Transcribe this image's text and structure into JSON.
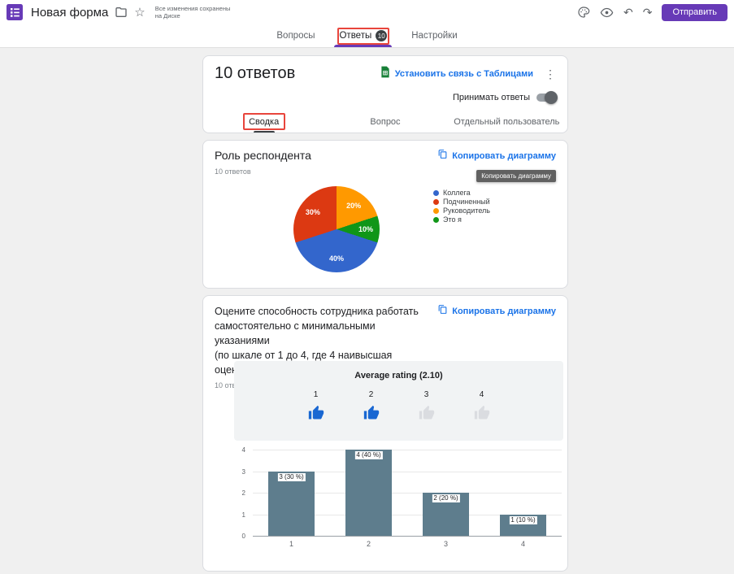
{
  "colors": {
    "accent": "#673ab7",
    "link": "#1a73e8",
    "annotation": "#e8453c",
    "bar": "#5e7d8d",
    "thumb_filled": "#1967d2",
    "thumb_empty": "#dadce0"
  },
  "topbar": {
    "app_title": "Новая форма",
    "saved_line1": "Все изменения сохранены",
    "saved_line2": "на Диске",
    "send_button": "Отправить"
  },
  "nav_tabs": {
    "questions": "Вопросы",
    "answers": "Ответы",
    "answers_badge": "10",
    "settings": "Настройки"
  },
  "summary_card": {
    "title": "10 ответов",
    "sheets_link": "Установить связь с Таблицами",
    "accepting_toggle_label": "Принимать ответы",
    "tab_summary": "Сводка",
    "tab_question": "Вопрос",
    "tab_individual": "Отдельный пользователь"
  },
  "pie_card": {
    "title": "Роль респондента",
    "responses_label": "10 ответов",
    "copy_chart_link": "Копировать диаграмму",
    "copy_chart_tooltip": "Копировать диаграмму"
  },
  "rating_card": {
    "title": "Оцените способность сотрудника работать самостоятельно с минимальными указаниями",
    "scale_note": "(по шкале от 1 до 4, где 4 наивысшая оценка)",
    "responses_label": "10 ответов",
    "copy_chart_link": "Копировать диаграмму",
    "average_title": "Average rating (2.10)"
  },
  "chart_data": [
    {
      "type": "pie",
      "title": "Роль респондента",
      "responses": 10,
      "slices": [
        {
          "label": "Коллега",
          "percent": 40,
          "color": "#3366cc"
        },
        {
          "label": "Подчиненный",
          "percent": 30,
          "color": "#dc3912"
        },
        {
          "label": "Руководитель",
          "percent": 20,
          "color": "#ff9900"
        },
        {
          "label": "Это я",
          "percent": 10,
          "color": "#109618"
        }
      ],
      "draw_order_clockwise_from_top": [
        2,
        3,
        0,
        1
      ],
      "legend_position": "right",
      "label_format": "percent"
    },
    {
      "type": "bar",
      "title": "Оцените способность сотрудника работать самостоятельно с минимальными указаниями (по шкале от 1 до 4, где 4 наивысшая оценка)",
      "responses": 10,
      "categories": [
        "1",
        "2",
        "3",
        "4"
      ],
      "values": [
        3,
        4,
        2,
        1
      ],
      "percentages": [
        30,
        40,
        20,
        10
      ],
      "bar_labels": [
        "3 (30 %)",
        "4 (40 %)",
        "2 (20 %)",
        "1 (10 %)"
      ],
      "ylim": [
        0,
        4
      ],
      "yticks": [
        4,
        3,
        2,
        1,
        0
      ],
      "bar_color": "#5e7d8d",
      "average": 2.1,
      "average_label": "Average rating (2.10)",
      "thumb_scale": [
        {
          "label": "1",
          "filled": true
        },
        {
          "label": "2",
          "filled": true
        },
        {
          "label": "3",
          "filled": false
        },
        {
          "label": "4",
          "filled": false
        }
      ],
      "grid": true,
      "legend_position": "none"
    }
  ]
}
